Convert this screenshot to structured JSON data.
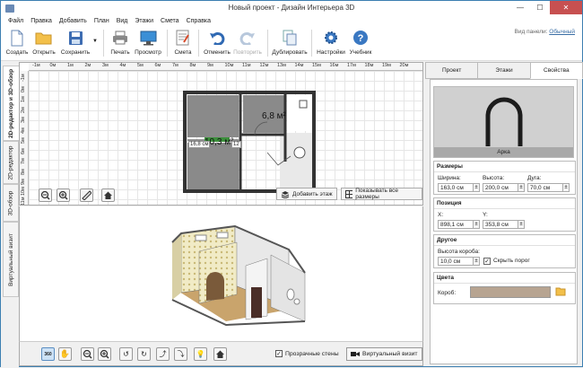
{
  "window": {
    "title": "Новый проект - Дизайн Интерьера 3D",
    "minimize": "—",
    "maximize": "☐",
    "close": "✕"
  },
  "menu": [
    "Файл",
    "Правка",
    "Добавить",
    "План",
    "Вид",
    "Этажи",
    "Смета",
    "Справка"
  ],
  "toolbar": {
    "create": "Создать",
    "open": "Открыть",
    "save": "Сохранить",
    "print": "Печать",
    "preview": "Просмотр",
    "estimate": "Смета",
    "undo": "Отменить",
    "redo": "Повторить",
    "duplicate": "Дублировать",
    "settings": "Настройки",
    "tutorial": "Учебник",
    "panel_view_label": "Вид панели:",
    "panel_view_value": "Обычный"
  },
  "left_tabs": [
    "2D-редактор и 3D-обзор",
    "2D-редактор",
    "3D-обзор",
    "Виртуальный визит"
  ],
  "plan": {
    "ruler_x": [
      "-1м",
      "0м",
      "1м",
      "2м",
      "3м",
      "4м",
      "5м",
      "6м",
      "7м",
      "8м",
      "9м",
      "10м",
      "11м",
      "12м",
      "13м",
      "14м",
      "15м",
      "16м",
      "17м",
      "18м",
      "19м",
      "20м"
    ],
    "ruler_y": [
      "-1м",
      "0м",
      "1м",
      "2м",
      "3м",
      "4м",
      "5м",
      "6м",
      "7м",
      "8м",
      "9м",
      "10м",
      "11м"
    ],
    "room_area_1": "6,8 м²",
    "room_area_2": "10,3 м²",
    "dim_1": "16,8 см",
    "dim_2": "12",
    "add_floor": "Добавить этаж",
    "show_all_floors": "Показывать все размеры"
  },
  "bottom": {
    "transparent_walls": "Прозрачные стены",
    "virtual_visit": "Виртуальный визит"
  },
  "right_panel": {
    "tabs": [
      "Проект",
      "Этажи",
      "Свойства"
    ],
    "active_tab": "Свойства",
    "preview_caption": "Арка",
    "sizes": {
      "header": "Размеры",
      "width_label": "Ширина:",
      "width": "163,0 см",
      "height_label": "Высота:",
      "height": "200,0 см",
      "arc_label": "Дуга:",
      "arc": "70,0 см"
    },
    "position": {
      "header": "Позиция",
      "x_label": "X:",
      "x": "898,1 см",
      "y_label": "Y:",
      "y": "353,8 см"
    },
    "other": {
      "header": "Другое",
      "box_height_label": "Высота короба:",
      "box_height": "10,0 см",
      "hide_threshold": "Скрыть порог"
    },
    "colors": {
      "header": "Цвета",
      "box_label": "Короб:",
      "box_color": "#b7a491"
    }
  }
}
